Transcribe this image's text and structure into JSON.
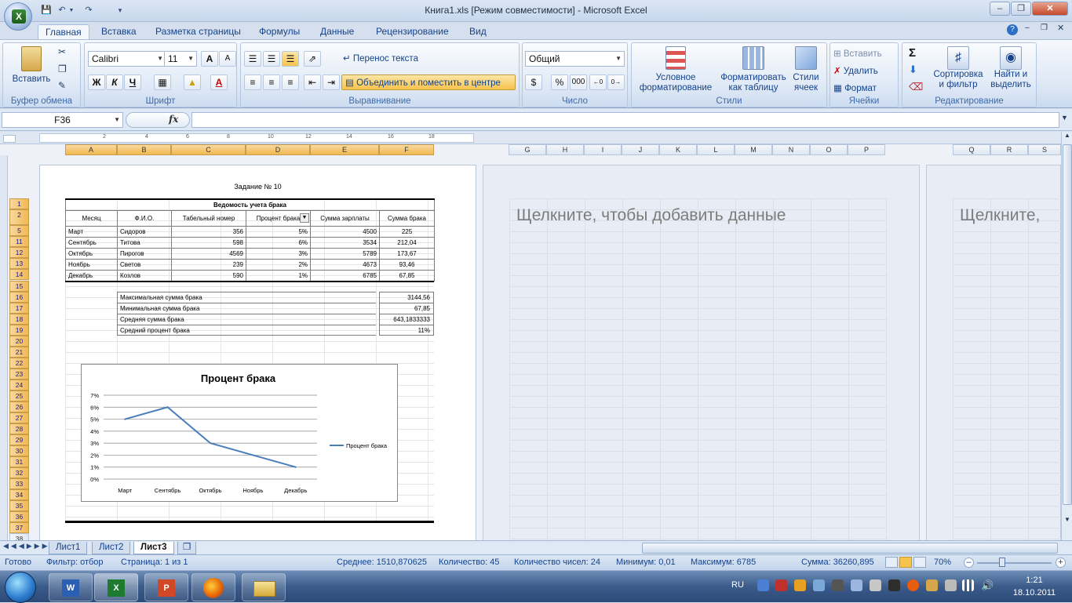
{
  "title": "Книга1.xls  [Режим совместимости] - Microsoft Excel",
  "tabs": [
    "Главная",
    "Вставка",
    "Разметка страницы",
    "Формулы",
    "Данные",
    "Рецензирование",
    "Вид"
  ],
  "ribbon": {
    "clipboard": {
      "paste": "Вставить",
      "label": "Буфер обмена"
    },
    "font": {
      "name": "Calibri",
      "size": "11",
      "bold": "Ж",
      "italic": "К",
      "underline": "Ч",
      "label": "Шрифт"
    },
    "alignment": {
      "wrap": "Перенос текста",
      "merge": "Объединить и поместить в центре",
      "label": "Выравнивание"
    },
    "number": {
      "format": "Общий",
      "percent": "%",
      "thousands": "000",
      "label": "Число"
    },
    "styles": {
      "conditional": [
        "Условное",
        "форматирование"
      ],
      "table": [
        "Форматировать",
        "как таблицу"
      ],
      "cell": [
        "Стили",
        "ячеек"
      ],
      "label": "Стили"
    },
    "cells": {
      "insert": "Вставить",
      "delete": "Удалить",
      "format": "Формат",
      "label": "Ячейки"
    },
    "editing": {
      "sort": [
        "Сортировка",
        "и фильтр"
      ],
      "find": [
        "Найти и",
        "выделить"
      ],
      "label": "Редактирование"
    }
  },
  "formula_bar": {
    "name_box": "F36",
    "fx": "fx",
    "value": ""
  },
  "columns_page1": [
    "A",
    "B",
    "C",
    "D",
    "E",
    "F"
  ],
  "columns_page2": [
    "G",
    "H",
    "I",
    "J",
    "K",
    "L",
    "M",
    "N",
    "O",
    "P"
  ],
  "columns_page3": [
    "Q",
    "R",
    "S"
  ],
  "rows": [
    "1",
    "2",
    "5",
    "11",
    "12",
    "13",
    "14",
    "15",
    "16",
    "17",
    "18",
    "19",
    "20",
    "21",
    "22",
    "23",
    "24",
    "25",
    "26",
    "27",
    "28",
    "29",
    "30",
    "31",
    "32",
    "33",
    "34",
    "35",
    "36",
    "37",
    "38"
  ],
  "ruler_marks": [
    "2",
    "4",
    "6",
    "8",
    "10",
    "12",
    "14",
    "16",
    "18"
  ],
  "sheet": {
    "task_title": "Задание № 10",
    "table_title": "Ведомость учета брака",
    "headers": [
      "Месяц",
      "Ф.И.О.",
      "Табельный номер",
      "Процент брака",
      "Сумма зарплаты",
      "Сумма брака"
    ],
    "data_rows": [
      [
        "Март",
        "Сидоров",
        "356",
        "5%",
        "4500",
        "225"
      ],
      [
        "Сентябрь",
        "Титова",
        "598",
        "6%",
        "3534",
        "212,04"
      ],
      [
        "Октябрь",
        "Пирогов",
        "4569",
        "3%",
        "5789",
        "173,67"
      ],
      [
        "Ноябрь",
        "Светов",
        "239",
        "2%",
        "4673",
        "93,46"
      ],
      [
        "Декабрь",
        "Козлов",
        "590",
        "1%",
        "6785",
        "67,85"
      ]
    ],
    "summary": [
      {
        "label": "Максимальная сумма брака",
        "value": "3144,56"
      },
      {
        "label": "Минимальная сумма брака",
        "value": "67,85"
      },
      {
        "label": "Средняя сумма брака",
        "value": "643,1833333"
      },
      {
        "label": "Средний процент брака",
        "value": "11%"
      }
    ],
    "click_to_add": "Щелкните, чтобы добавить данные",
    "click_to_add_short": "Щелкните,"
  },
  "chart_data": {
    "type": "line",
    "title": "Процент брака",
    "categories": [
      "Март",
      "Сентябрь",
      "Октябрь",
      "Ноябрь",
      "Декабрь"
    ],
    "series": [
      {
        "name": "Процент брака",
        "values": [
          0.05,
          0.06,
          0.03,
          0.02,
          0.01
        ],
        "color": "#4a7ebb"
      }
    ],
    "ylim": [
      0,
      0.07
    ],
    "yticks": [
      "0%",
      "1%",
      "2%",
      "3%",
      "4%",
      "5%",
      "6%",
      "7%"
    ],
    "grid": true,
    "legend": "right"
  },
  "sheet_tabs": [
    "Лист1",
    "Лист2",
    "Лист3"
  ],
  "active_sheet": "Лист3",
  "status": {
    "ready": "Готово",
    "filter": "Фильтр: отбор",
    "page": "Страница: 1 из 1",
    "average": "Среднее: 1510,870625",
    "count": "Количество: 45",
    "numcount": "Количество чисел: 24",
    "min": "Минимум: 0,01",
    "max": "Максимум: 6785",
    "sum": "Сумма: 36260,895",
    "zoom": "70%"
  },
  "taskbar": {
    "lang": "RU",
    "time": "1:21",
    "date": "18.10.2011"
  }
}
